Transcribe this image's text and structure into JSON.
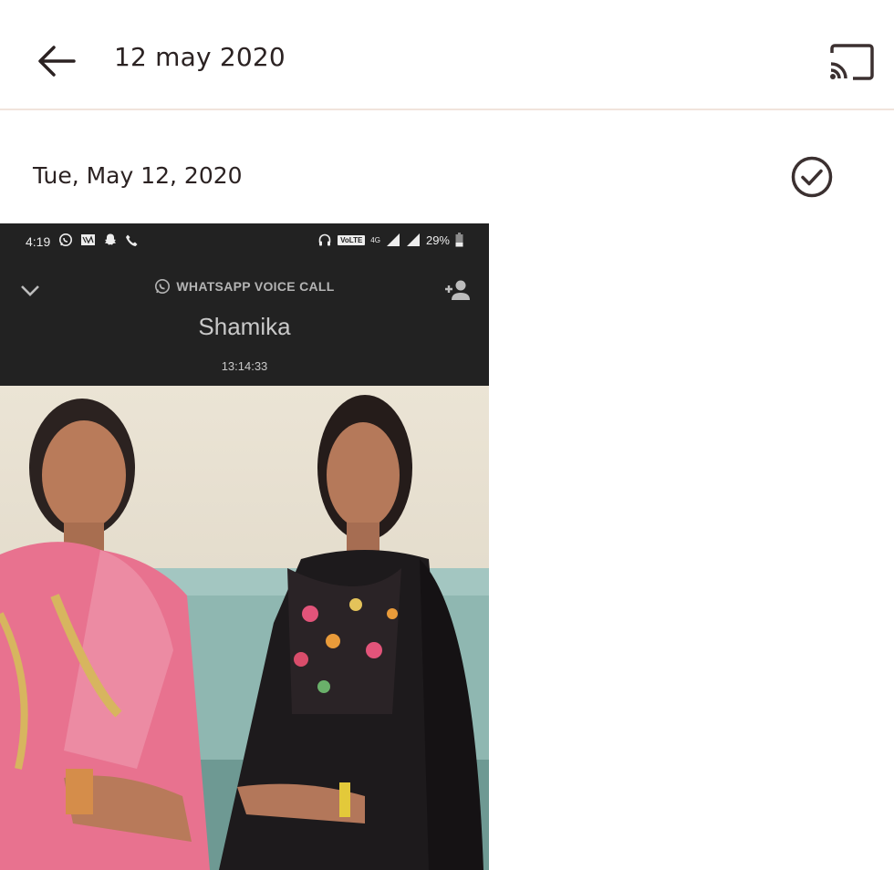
{
  "appbar": {
    "title": "12 may 2020",
    "back_icon": "arrow-left-icon",
    "cast_icon": "cast-icon"
  },
  "group": {
    "date_label": "Tue, May 12, 2020",
    "select_icon": "check-circle-icon"
  },
  "thumbnail": {
    "status_bar": {
      "time": "4:19",
      "volte": "VoLTE",
      "network": "4G",
      "battery": "29%"
    },
    "call": {
      "type_label": "WHATSAPP VOICE CALL",
      "caller_name": "Shamika",
      "duration": "13:14:33"
    }
  },
  "colors": {
    "icon": "#3b3030",
    "divider": "#f1e4dc",
    "call_bg": "#222222"
  }
}
